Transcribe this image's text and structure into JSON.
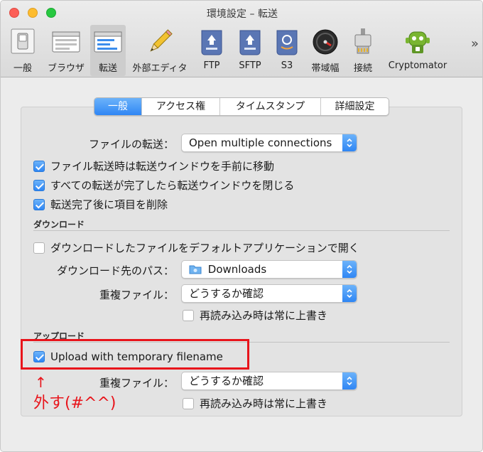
{
  "window": {
    "title": "環境設定 – 転送"
  },
  "toolbar": {
    "items": [
      {
        "label": "一般"
      },
      {
        "label": "ブラウザ"
      },
      {
        "label": "転送"
      },
      {
        "label": "外部エディタ"
      },
      {
        "label": "FTP"
      },
      {
        "label": "SFTP"
      },
      {
        "label": "S3"
      },
      {
        "label": "帯域幅"
      },
      {
        "label": "接続"
      },
      {
        "label": "Cryptomator"
      }
    ],
    "selected": "転送",
    "overflow": "»"
  },
  "tabs": [
    {
      "label": "一般",
      "active": true
    },
    {
      "label": "アクセス権",
      "active": false
    },
    {
      "label": "タイムスタンプ",
      "active": false
    },
    {
      "label": "詳細設定",
      "active": false
    }
  ],
  "general": {
    "transfer_label": "ファイルの転送：",
    "transfer_value": "Open multiple connections",
    "checks": [
      {
        "label": "ファイル転送時は転送ウインドウを手前に移動",
        "checked": true
      },
      {
        "label": "すべての転送が完了したら転送ウインドウを閉じる",
        "checked": true
      },
      {
        "label": "転送完了後に項目を削除",
        "checked": true
      }
    ]
  },
  "download": {
    "heading": "ダウンロード",
    "open_default": {
      "label": "ダウンロードしたファイルをデフォルトアプリケーションで開く",
      "checked": false
    },
    "path_label": "ダウンロード先のパス：",
    "path_value": "Downloads",
    "dup_label": "重複ファイル：",
    "dup_value": "どうするか確認",
    "overwrite": {
      "label": "再読み込み時は常に上書き",
      "checked": false
    }
  },
  "upload": {
    "heading": "アップロード",
    "temp_name": {
      "label": "Upload with temporary filename",
      "checked": true
    },
    "dup_label": "重複ファイル：",
    "dup_value": "どうするか確認",
    "overwrite": {
      "label": "再読み込み時は常に上書き",
      "checked": false
    }
  },
  "annotation": {
    "arrow": "↑",
    "text": "外す(#^^)",
    "color": "#e8141b"
  },
  "colors": {
    "accent": "#2f86f4",
    "annotation": "#e8141b"
  }
}
